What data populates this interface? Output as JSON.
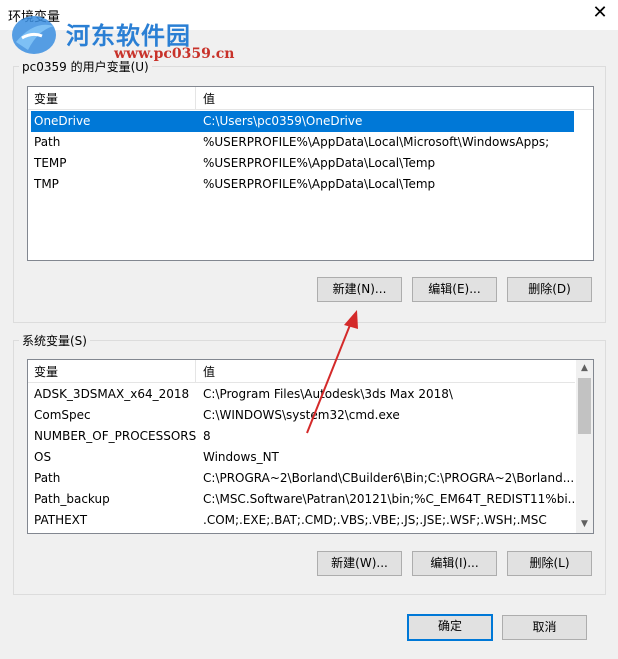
{
  "window": {
    "title": "环境变量",
    "close_glyph": "✕"
  },
  "watermark": {
    "site_name": "河东软件园",
    "url": "www.pc0359.cn"
  },
  "user_vars": {
    "group_label": "pc0359 的用户变量(U)",
    "columns": [
      "变量",
      "值"
    ],
    "rows": [
      {
        "name": "OneDrive",
        "value": "C:\\Users\\pc0359\\OneDrive",
        "selected": true
      },
      {
        "name": "Path",
        "value": "%USERPROFILE%\\AppData\\Local\\Microsoft\\WindowsApps;"
      },
      {
        "name": "TEMP",
        "value": "%USERPROFILE%\\AppData\\Local\\Temp"
      },
      {
        "name": "TMP",
        "value": "%USERPROFILE%\\AppData\\Local\\Temp"
      }
    ],
    "buttons": {
      "new": "新建(N)...",
      "edit": "编辑(E)...",
      "delete": "删除(D)"
    }
  },
  "system_vars": {
    "group_label": "系统变量(S)",
    "columns": [
      "变量",
      "值"
    ],
    "rows": [
      {
        "name": "ADSK_3DSMAX_x64_2018",
        "value": "C:\\Program Files\\Autodesk\\3ds Max 2018\\"
      },
      {
        "name": "ComSpec",
        "value": "C:\\WINDOWS\\system32\\cmd.exe"
      },
      {
        "name": "NUMBER_OF_PROCESSORS",
        "value": "8"
      },
      {
        "name": "OS",
        "value": "Windows_NT"
      },
      {
        "name": "Path",
        "value": "C:\\PROGRA~2\\Borland\\CBuilder6\\Bin;C:\\PROGRA~2\\Borland..."
      },
      {
        "name": "Path_backup",
        "value": "C:\\MSC.Software\\Patran\\20121\\bin;%C_EM64T_REDIST11%bi..."
      },
      {
        "name": "PATHEXT",
        "value": ".COM;.EXE;.BAT;.CMD;.VBS;.VBE;.JS;.JSE;.WSF;.WSH;.MSC"
      }
    ],
    "buttons": {
      "new": "新建(W)...",
      "edit": "编辑(I)...",
      "delete": "删除(L)"
    }
  },
  "footer": {
    "ok": "确定",
    "cancel": "取消"
  },
  "colors": {
    "selection": "#0078d7",
    "arrow": "#d42a2a",
    "watermark_blue": "#2a7fd4",
    "watermark_red": "#c8322a"
  },
  "icons": [
    "close-icon",
    "watermark-logo-icon",
    "scroll-up-icon",
    "scroll-down-icon",
    "annotation-arrow-icon"
  ]
}
